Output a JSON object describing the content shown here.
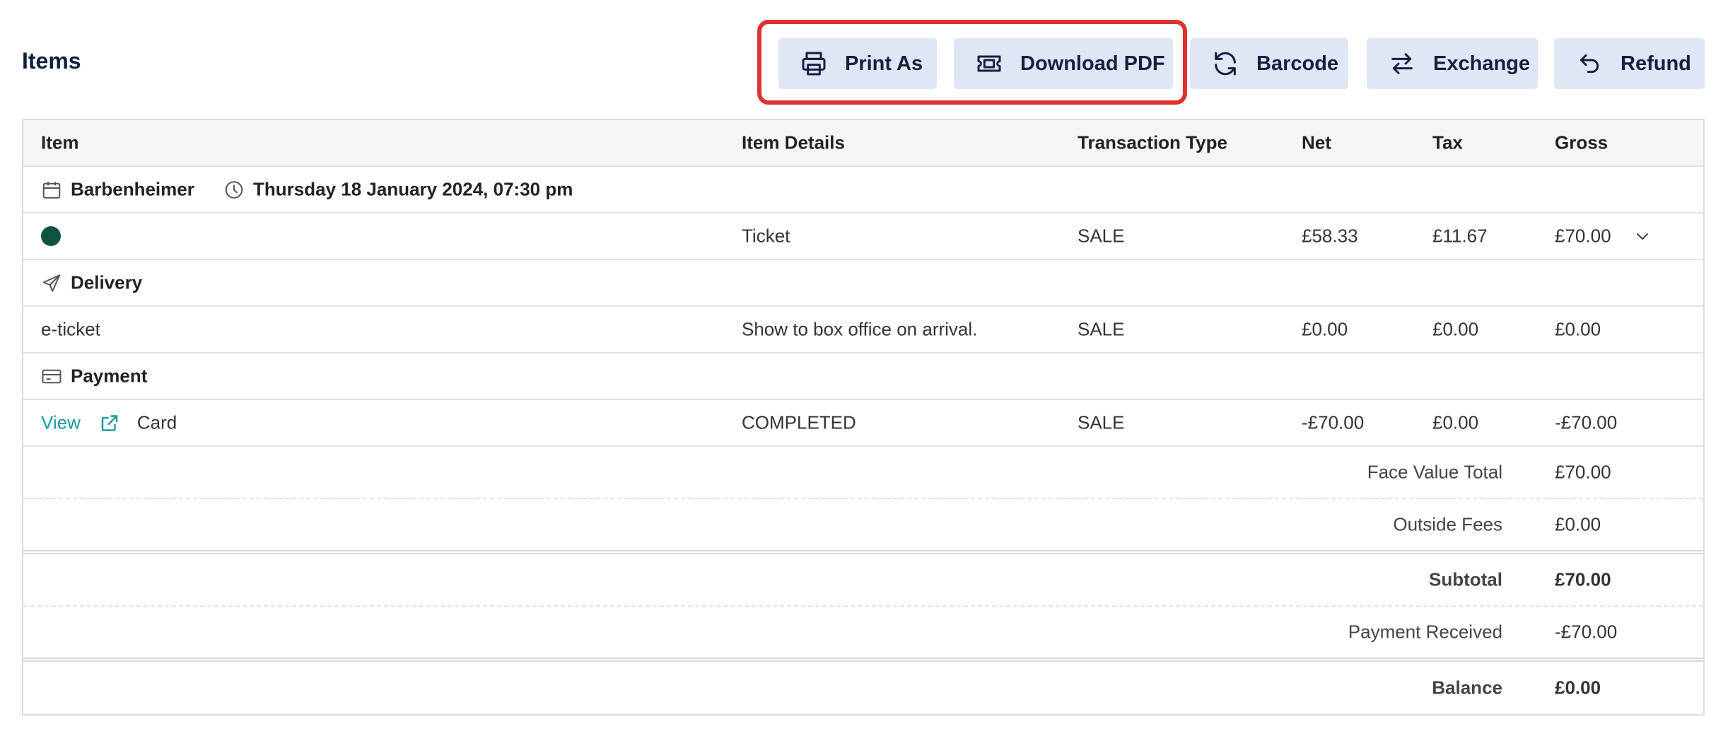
{
  "page": {
    "title": "Items"
  },
  "toolbar": {
    "print_label": "Print As",
    "download_label": "Download PDF",
    "barcode_label": "Barcode",
    "exchange_label": "Exchange",
    "refund_label": "Refund",
    "highlight_color": "#e0302f",
    "button_bg": "#dfe6f4"
  },
  "table": {
    "headers": [
      "Item",
      "Item Details",
      "Transaction Type",
      "Net",
      "Tax",
      "Gross"
    ],
    "event": {
      "name": "Barbenheimer",
      "datetime": "Thursday 18 January 2024, 07:30 pm"
    },
    "ticket_row": {
      "details": "Ticket",
      "type": "SALE",
      "net": "£58.33",
      "tax": "£11.67",
      "gross": "£70.00",
      "dot_color": "#0f5240"
    },
    "delivery_section": "Delivery",
    "delivery_row": {
      "item": "e-ticket",
      "details": "Show to box office on arrival.",
      "type": "SALE",
      "net": "£0.00",
      "tax": "£0.00",
      "gross": "£0.00"
    },
    "payment_section": "Payment",
    "payment_row": {
      "view": "View",
      "method": "Card",
      "details": "COMPLETED",
      "type": "SALE",
      "net": "-£70.00",
      "tax": "£0.00",
      "gross": "-£70.00"
    }
  },
  "totals": {
    "face_value_label": "Face Value Total",
    "face_value": "£70.00",
    "outside_fees_label": "Outside Fees",
    "outside_fees": "£0.00",
    "subtotal_label": "Subtotal",
    "subtotal": "£70.00",
    "payment_received_label": "Payment Received",
    "payment_received": "-£70.00",
    "balance_label": "Balance",
    "balance": "£0.00"
  }
}
